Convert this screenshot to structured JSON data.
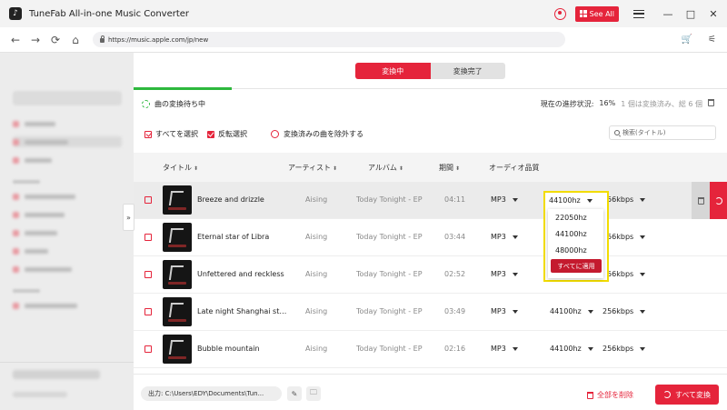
{
  "app": {
    "title": "TuneFab All-in-one Music Converter",
    "see_all_label": "See All"
  },
  "browser": {
    "url": "https://music.apple.com/jp/new",
    "back": "←",
    "forward": "→",
    "reload": "⟳",
    "home": "⌂",
    "cart": "🛒",
    "filter": "⚟"
  },
  "sidebar": {
    "collapse_glyph": "»"
  },
  "tabs": [
    {
      "label": "変換中"
    },
    {
      "label": "変換完了"
    }
  ],
  "status": {
    "message": "曲の変換待ち中",
    "progress_label": "現在の進捗状況:",
    "progress_value": "16%",
    "progress_fraction": 0.16,
    "detail": "1 個は変換済み、総 6 個"
  },
  "actions": {
    "select_all": "すべてを選択",
    "invert_select": "反転選択",
    "exclude_converted": "変換済みの曲を除外する",
    "search_placeholder": "検索(タイトル)"
  },
  "table": {
    "headers": {
      "title": "タイトル",
      "artist": "アーティスト",
      "album": "アルバム",
      "duration": "期間",
      "quality": "オーディオ品質"
    },
    "sort_glyph": "⬍",
    "rows": [
      {
        "title": "Breeze and drizzle",
        "artist": "Aising",
        "album": "Today Tonight - EP",
        "duration": "04:11",
        "format": "MP3",
        "hz": "44100hz",
        "kbps": "256kbps"
      },
      {
        "title": "Eternal star of Libra",
        "artist": "Aising",
        "album": "Today Tonight - EP",
        "duration": "03:44",
        "format": "MP3",
        "hz": "44100hz",
        "kbps": "256kbps"
      },
      {
        "title": "Unfettered and reckless",
        "artist": "Aising",
        "album": "Today Tonight - EP",
        "duration": "02:52",
        "format": "MP3",
        "hz": "44100hz",
        "kbps": "256kbps"
      },
      {
        "title": "Late night Shanghai str...",
        "artist": "Aising",
        "album": "Today Tonight - EP",
        "duration": "03:49",
        "format": "MP3",
        "hz": "44100hz",
        "kbps": "256kbps"
      },
      {
        "title": "Bubble mountain",
        "artist": "Aising",
        "album": "Today Tonight - EP",
        "duration": "02:16",
        "format": "MP3",
        "hz": "44100hz",
        "kbps": "256kbps"
      }
    ]
  },
  "dropdown": {
    "current": "44100hz",
    "options": [
      "22050hz",
      "44100hz",
      "48000hz"
    ],
    "apply_all": "すべてに適用"
  },
  "bottom": {
    "output_path": "出力: C:\\Users\\EDY\\Documents\\Tun...",
    "edit_glyph": "✎",
    "folder_glyph": "🗀",
    "delete_all": "全部を削除",
    "convert_all": "すべて変換"
  },
  "colors": {
    "accent": "#e5243b",
    "progress": "#2db83d",
    "highlight": "#f2dc00"
  }
}
